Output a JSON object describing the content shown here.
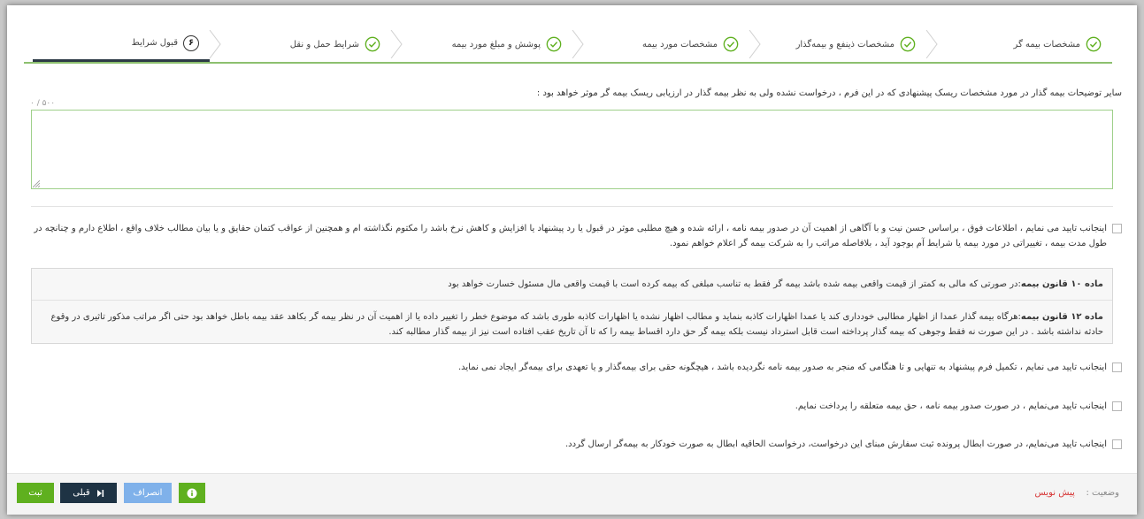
{
  "steps": [
    {
      "label": "مشخصات بیمه گر",
      "state": "done",
      "icon": "check-circle-icon"
    },
    {
      "label": "مشخصات ذینفع و بیمه‌گذار",
      "state": "done",
      "icon": "check-circle-icon"
    },
    {
      "label": "مشخصات مورد بیمه",
      "state": "done",
      "icon": "check-circle-icon"
    },
    {
      "label": "پوشش و مبلغ مورد بیمه",
      "state": "done",
      "icon": "check-circle-icon"
    },
    {
      "label": "شرایط حمل و نقل",
      "state": "done",
      "icon": "check-circle-icon"
    },
    {
      "label": "قبول شرایط",
      "state": "active",
      "number": "۶"
    }
  ],
  "description": {
    "label": "سایر توضیحات بیمه گذار در مورد مشخصات ریسک پیشنهادی که در این فرم ، درخواست نشده ولی به نظر بیمه گذار در ارزیابی ریسک بیمه گر موثر خواهد بود :",
    "counter": "۰ / ۵۰۰",
    "value": ""
  },
  "declaration_1": "اینجانب تایید می نمایم ، اطلاعات فوق ، براساس حسن نیت و با آگاهی از اهمیت آن در صدور بیمه نامه ، ارائه شده و هیچ مطلبی موثر در قبول یا رد پیشنهاد یا افزایش و کاهش نرخ باشد را مکتوم نگذاشته ام و همچنین از عواقب کتمان حقایق و یا بیان مطالب خلاف واقع ، اطلاع دارم و چنانچه در طول مدت بیمه ، تغییراتی در مورد بیمه یا شرایط آم بوجود آید ، بلافاصله مراتب را به شرکت بیمه گر اعلام خواهم نمود.",
  "laws": {
    "law10_title": "ماده ۱۰ قانون بیمه",
    "law10_text": ":در صورتی که مالی به کمتر از قیمت واقعی بیمه شده باشد بیمه گر فقط به تناسب مبلغی که بیمه کرده است با قیمت واقعی مال مسئول خسارت خواهد بود",
    "law12_title": "ماده ۱۲ قانون بیمه",
    "law12_text": ":هرگاه بیمه گذار عمدا از اظهار مطالبی خودداری کند یا عمدا اظهارات کاذبه بنماید و مطالب اظهار نشده یا اظهارات کاذبه طوری باشد که موضوع خطر را تغییر داده یا از اهمیت آن در نظر بیمه گر بکاهد عقد بیمه باطل خواهد بود حتی اگر مراتب مذکور تاثیری در وقوع حادثه نداشته باشد . در این صورت نه فقط وجوهی که بیمه گذار پرداخته است قابل استرداد نیست بلکه بیمه گر حق دارد اقساط بیمه را که تا آن تاریخ عقب افتاده است نیز از بیمه گذار مطالبه کند."
  },
  "declaration_2": "اینجانب تایید می نمایم ، تکمیل فرم پیشنهاد به تنهایی و تا هنگامی که منجر به صدور بیمه نامه نگردیده باشد ، هیچگونه حقی برای بیمه‌گذار و یا تعهدی برای بیمه‌گر ایجاد نمی نماید.",
  "declaration_3": "اینجانب تایید می‌نمایم ، در صورت صدور بیمه نامه ، حق بیمه متعلقه را پرداخت نمایم.",
  "declaration_4": "اینجانب تایید می‌نمایم، در صورت ابطال پرونده ثبت سفارش مبنای این درخواست، درخواست الحاقیه ابطال به صورت خودکار به بیمه‌گر ارسال گردد.",
  "footer": {
    "status_label": "وضعیت :",
    "status_value": "پیش نویس",
    "submit_label": "ثبت",
    "prev_label": "قبلی",
    "cancel_label": "انصراف"
  },
  "colors": {
    "accent_green": "#5fb01f",
    "navy": "#1e3344",
    "light_blue": "#7fb1ea",
    "status_red": "#d63232"
  }
}
